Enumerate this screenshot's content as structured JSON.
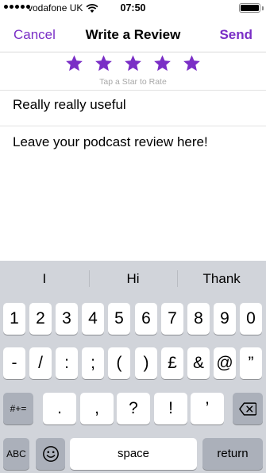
{
  "status_bar": {
    "carrier": "vodafone UK",
    "time": "07:50",
    "signal_bars_filled": 5,
    "battery_level": 1.0
  },
  "nav": {
    "cancel_label": "Cancel",
    "title": "Write a Review",
    "send_label": "Send"
  },
  "rating": {
    "stars_filled": 5,
    "stars_total": 5,
    "hint": "Tap a Star to Rate",
    "star_color": "#7a2ec6"
  },
  "form": {
    "title_value": "Really really useful",
    "review_placeholder": "Leave your podcast review here!"
  },
  "keyboard": {
    "predictions": [
      "I",
      "Hi",
      "Thank"
    ],
    "row1": [
      "1",
      "2",
      "3",
      "4",
      "5",
      "6",
      "7",
      "8",
      "9",
      "0"
    ],
    "row2": [
      "-",
      "/",
      ":",
      ";",
      "(",
      ")",
      "£",
      "&",
      "@",
      "”"
    ],
    "mode_toggle": "#+=",
    "row3": [
      ".",
      ",",
      "?",
      "!",
      "’"
    ],
    "backspace_icon": "backspace-icon",
    "abc_label": "ABC",
    "emoji_icon": "emoji-icon",
    "space_label": "space",
    "return_label": "return"
  },
  "colors": {
    "accent": "#7a2ec6",
    "keyboard_bg": "#d1d4da",
    "key_bg": "#ffffff",
    "key_dark_bg": "#abb0ba"
  }
}
